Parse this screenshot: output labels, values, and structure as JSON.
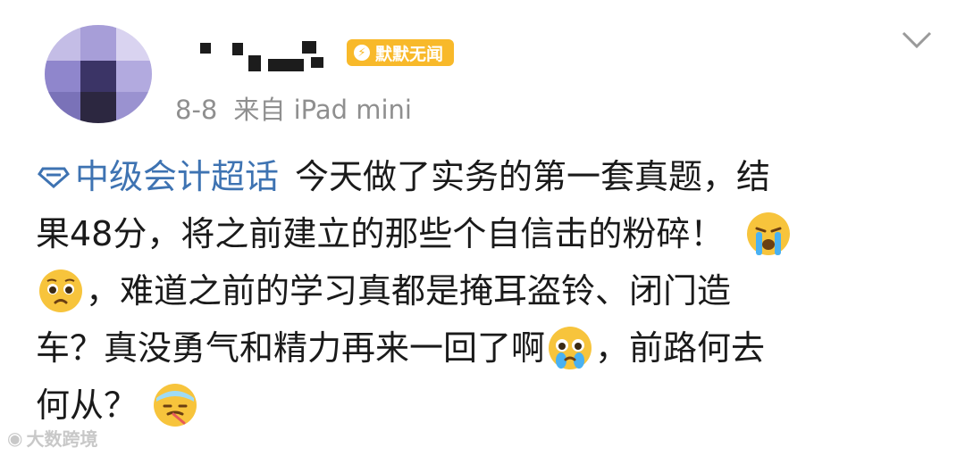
{
  "post": {
    "user_badge": "默默无闻",
    "date": "8-8",
    "source": "来自 iPad mini",
    "topic": "中级会计超话",
    "lines": [
      "今天做了实务的第一套真题，结",
      "果48分，将之前建立的那些个自信击的粉碎！",
      "，难道之前的学习真都是掩耳盗铃、闭门造",
      "车？真没勇气和精力再来一回了啊",
      "，前路何去",
      "何从？"
    ]
  },
  "icons": {
    "topic": "diamond-icon",
    "more": "chevron-down-icon",
    "emojis": [
      "crying-face-emoji",
      "pleading-face-emoji",
      "teary-eyes-emoji",
      "sick-face-emoji"
    ]
  },
  "watermark": {
    "text": "大数跨境"
  },
  "colors": {
    "topic": "#3e73b2",
    "badge": "#f8b92a",
    "meta": "#8f8f8f"
  }
}
